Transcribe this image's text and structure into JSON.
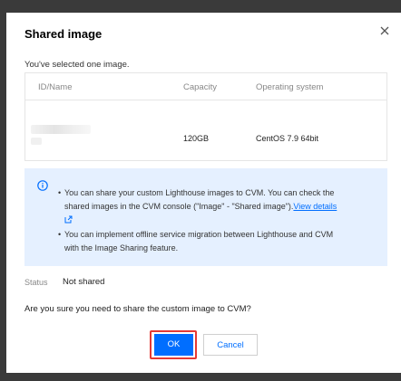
{
  "dialog": {
    "title": "Shared image",
    "selected_note": "You've selected one image.",
    "close_icon": "close-icon"
  },
  "table": {
    "columns": [
      "ID/Name",
      "Capacity",
      "Operating system"
    ],
    "rows": [
      {
        "id_name": "",
        "capacity": "120GB",
        "os": "CentOS 7.9 64bit"
      }
    ]
  },
  "info": {
    "icon": "info-icon",
    "bullet1_line1": "You can share your custom Lighthouse images to CVM. You can check the",
    "bullet1_line2": "shared images in the CVM console (\"Image\" - \"Shared image\").",
    "bullet1_link": "View details",
    "bullet2_line1": "You can implement offline service migration between Lighthouse and CVM",
    "bullet2_line2": "with the Image Sharing feature."
  },
  "status": {
    "label": "Status",
    "value": "Not shared"
  },
  "confirm_question": "Are you sure you need to share the custom image to CVM?",
  "buttons": {
    "ok": "OK",
    "cancel": "Cancel"
  },
  "colors": {
    "accent": "#006eff",
    "info_bg": "#e5f0ff",
    "highlight": "#e53935"
  }
}
